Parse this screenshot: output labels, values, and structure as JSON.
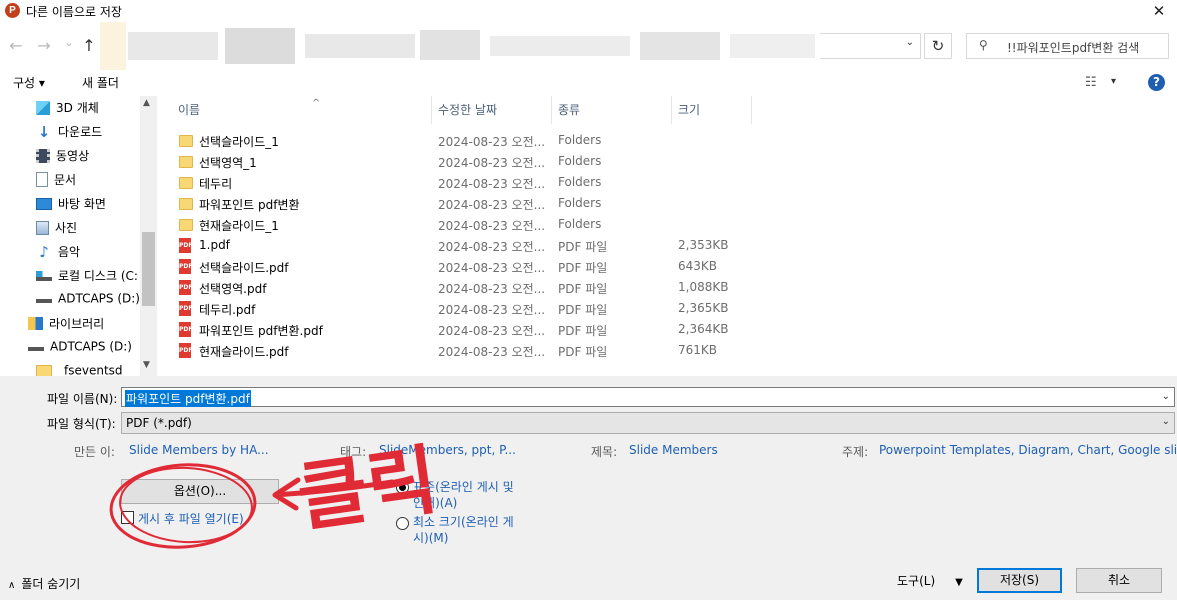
{
  "window": {
    "app_icon_letter": "P",
    "title": "다른 이름으로 저장",
    "close_glyph": "✕"
  },
  "address": {
    "back_glyph": "←",
    "forward_glyph": "→",
    "recent_glyph": "⌄",
    "up_glyph": "↑",
    "dropdown_glyph": "⌄",
    "refresh_glyph": "↻",
    "search_glyph": "⚲",
    "search_placeholder": "!!파워포인트pdf변환 검색"
  },
  "toolbar": {
    "organize_label": "구성 ▾",
    "new_folder_label": "새 폴더",
    "view_glyph": "☷",
    "view_chevron": "▾",
    "help_glyph": "?"
  },
  "nav": {
    "items": [
      {
        "label": "3D 개체",
        "icon": "cube-3d-icon"
      },
      {
        "label": "다운로드",
        "icon": "download-arrow-icon"
      },
      {
        "label": "동영상",
        "icon": "video-icon"
      },
      {
        "label": "문서",
        "icon": "document-icon"
      },
      {
        "label": "바탕 화면",
        "icon": "desktop-icon"
      },
      {
        "label": "사진",
        "icon": "pictures-icon"
      },
      {
        "label": "음악",
        "icon": "music-icon"
      },
      {
        "label": "로컬 디스크 (C:",
        "icon": "local-disk-icon"
      },
      {
        "label": "ADTCAPS (D:)",
        "icon": "drive-icon"
      },
      {
        "label": "라이브러리",
        "icon": "library-icon"
      },
      {
        "label": "ADTCAPS (D:)",
        "icon": "drive-icon"
      },
      {
        "label": "_fseventsd",
        "icon": "folder-icon"
      }
    ],
    "scroll_up": "▲",
    "scroll_down": "▼"
  },
  "columns": {
    "name": "이름",
    "modified": "수정한 날짜",
    "type": "종류",
    "size": "크기",
    "sort_glyph": "^"
  },
  "files": [
    {
      "name": "선택슬라이드_1",
      "date": "2024-08-23 오전...",
      "type": "Folders",
      "size": "",
      "kind": "folder"
    },
    {
      "name": "선택영역_1",
      "date": "2024-08-23 오전...",
      "type": "Folders",
      "size": "",
      "kind": "folder"
    },
    {
      "name": "테두리",
      "date": "2024-08-23 오전...",
      "type": "Folders",
      "size": "",
      "kind": "folder"
    },
    {
      "name": "파워포인트 pdf변환",
      "date": "2024-08-23 오전...",
      "type": "Folders",
      "size": "",
      "kind": "folder"
    },
    {
      "name": "현재슬라이드_1",
      "date": "2024-08-23 오전...",
      "type": "Folders",
      "size": "",
      "kind": "folder"
    },
    {
      "name": "1.pdf",
      "date": "2024-08-23 오전...",
      "type": "PDF 파일",
      "size": "2,353KB",
      "kind": "pdf"
    },
    {
      "name": "선택슬라이드.pdf",
      "date": "2024-08-23 오전...",
      "type": "PDF 파일",
      "size": "643KB",
      "kind": "pdf"
    },
    {
      "name": "선택영역.pdf",
      "date": "2024-08-23 오전...",
      "type": "PDF 파일",
      "size": "1,088KB",
      "kind": "pdf"
    },
    {
      "name": "테두리.pdf",
      "date": "2024-08-23 오전...",
      "type": "PDF 파일",
      "size": "2,365KB",
      "kind": "pdf"
    },
    {
      "name": "파워포인트 pdf변환.pdf",
      "date": "2024-08-23 오전...",
      "type": "PDF 파일",
      "size": "2,364KB",
      "kind": "pdf"
    },
    {
      "name": "현재슬라이드.pdf",
      "date": "2024-08-23 오전...",
      "type": "PDF 파일",
      "size": "761KB",
      "kind": "pdf"
    }
  ],
  "pdf_icon_text": "PDF",
  "form": {
    "filename_label": "파일 이름(N):",
    "filename_value": "파워포인트 pdf변환.pdf",
    "filetype_label": "파일 형식(T):",
    "filetype_value": "PDF (*.pdf)",
    "chevron": "⌄"
  },
  "meta": {
    "author_label": "만든 이:",
    "author_value": "Slide Members by HA...",
    "tags_label": "태그:",
    "tags_value": "SlideMembers, ppt, P...",
    "title_label": "제목:",
    "title_value": "Slide Members",
    "subject_label": "주제:",
    "subject_value": "Powerpoint Templates, Diagram, Chart, Google slide..."
  },
  "options": {
    "options_button": "옵션(O)...",
    "open_after_label": "게시 후 파일 열기(E)",
    "open_after_checked": false,
    "standard_line1": "표준(온라인 게시 및",
    "standard_line2": "인쇄)(A)",
    "minimum_line1": "최소 크기(온라인 게",
    "minimum_line2": "시)(M)",
    "selected": "standard"
  },
  "footer": {
    "hide_folders": "폴더 숨기기",
    "hide_glyph": "∧",
    "tools_label": "도구(L)",
    "tools_glyph": "▼",
    "save_label": "저장(S)",
    "cancel_label": "취소"
  },
  "annotation": {
    "text": "클릭",
    "color": "#e02a36"
  }
}
